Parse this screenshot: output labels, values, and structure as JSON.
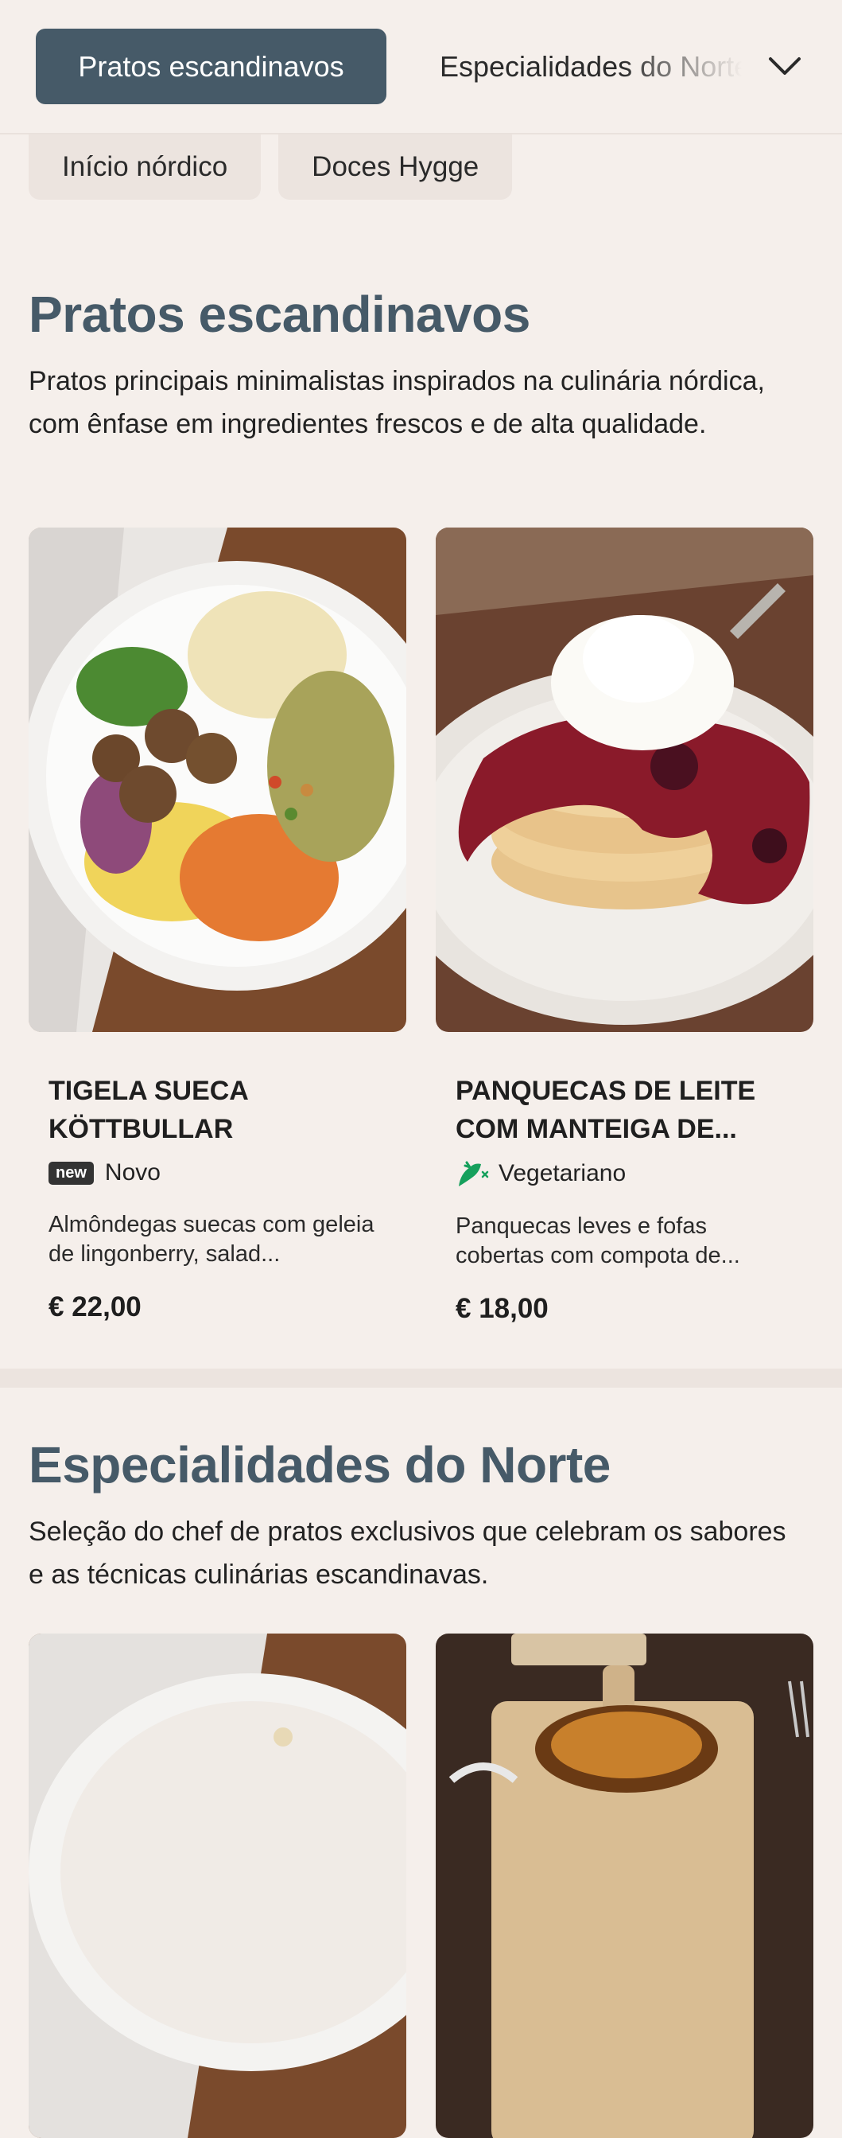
{
  "nav": {
    "active_category": "Pratos escandinavos",
    "next_category": "Especialidades do Norte",
    "subcategories": [
      "Início nórdico",
      "Doces Hygge"
    ]
  },
  "sections": [
    {
      "title": "Pratos escandinavos",
      "description": "Pratos principais minimalistas inspirados na culinária nórdica, com ênfase em ingredientes frescos e de alta qualidade.",
      "items": [
        {
          "name": "TIGELA SUECA KÖTTBULLAR",
          "badge": "new",
          "tag": "Novo",
          "description": "Almôndegas suecas com geleia de lingonberry, salad...",
          "price": "€ 22,00"
        },
        {
          "name": "PANQUECAS DE LEITE COM MANTEIGA DE...",
          "tag": "Vegetariano",
          "tag_icon": "vegetarian-icon",
          "description": "Panquecas leves e fofas cobertas com compota de...",
          "price": "€ 18,00"
        }
      ]
    },
    {
      "title": "Especialidades do Norte",
      "description": "Seleção do chef de pratos exclusivos que celebram os sabores e as técnicas culinárias escandinavas."
    }
  ],
  "colors": {
    "background": "#f5efeb",
    "accent": "#465a68",
    "chip": "#ece4df",
    "vegetarian": "#16a05c"
  }
}
